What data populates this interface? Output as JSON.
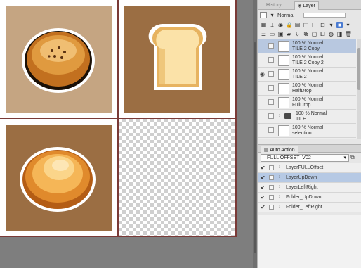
{
  "panel_tabs": {
    "history": "History",
    "layer": "Layer",
    "auto_action": "Auto Action"
  },
  "layer_panel": {
    "blend_mode": "Normal",
    "layers": [
      {
        "opacity": "100 % Normal",
        "name": "TILE 2 Copy",
        "selected": true,
        "visible": false,
        "kind": "tile"
      },
      {
        "opacity": "100 % Normal",
        "name": "TILE 2 Copy 2",
        "selected": false,
        "visible": false,
        "kind": "tile"
      },
      {
        "opacity": "100 % Normal",
        "name": "TILE 2",
        "selected": false,
        "visible": true,
        "kind": "tile"
      },
      {
        "opacity": "100 % Normal",
        "name": "HalfDrop",
        "selected": false,
        "visible": false,
        "kind": "tile"
      },
      {
        "opacity": "100 % Normal",
        "name": "FullDrop",
        "selected": false,
        "visible": false,
        "kind": "tile"
      },
      {
        "opacity": "100 % Normal",
        "name": "TILE",
        "selected": false,
        "visible": false,
        "kind": "folder"
      },
      {
        "opacity": "100 % Normal",
        "name": "selection",
        "selected": false,
        "visible": false,
        "kind": "selection"
      }
    ]
  },
  "auto_action": {
    "set_name": "FULL OFFSET_V02",
    "actions": [
      {
        "label": "LayerFULLOffset",
        "checked": true,
        "selected": false
      },
      {
        "label": "LayerUpDown",
        "checked": true,
        "selected": true
      },
      {
        "label": "LayerLeftRight",
        "checked": true,
        "selected": false
      },
      {
        "label": "Folder_UpDown",
        "checked": true,
        "selected": false
      },
      {
        "label": "Folder_LeftRight",
        "checked": true,
        "selected": false
      }
    ]
  },
  "icons": {
    "canvas_tiles": [
      "bun-icon",
      "toast-bread-icon",
      "cream-bun-icon",
      "transparent-tile"
    ],
    "accent": "#4a7bd1"
  }
}
